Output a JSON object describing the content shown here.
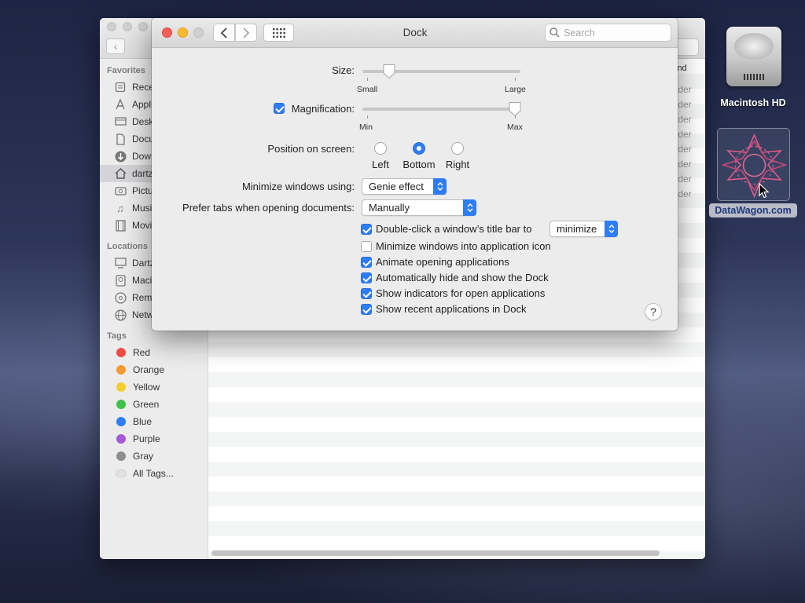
{
  "colors": {
    "accent": "#2f7df6",
    "close": "#fc5f57",
    "minimize": "#fdbc2e"
  },
  "finder": {
    "sidebar": {
      "favorites_header": "Favorites",
      "favorites": [
        {
          "label": "Rece",
          "icon": "recents-icon"
        },
        {
          "label": "Appli",
          "icon": "applications-icon"
        },
        {
          "label": "Desk",
          "icon": "desktop-icon"
        },
        {
          "label": "Docu",
          "icon": "documents-icon"
        },
        {
          "label": "Down",
          "icon": "downloads-icon"
        },
        {
          "label": "dartz",
          "icon": "home-icon"
        },
        {
          "label": "Pictu",
          "icon": "pictures-icon"
        },
        {
          "label": "Music",
          "icon": "music-icon"
        },
        {
          "label": "Movie",
          "icon": "movies-icon"
        }
      ],
      "locations_header": "Locations",
      "locations": [
        {
          "label": "Dartz",
          "icon": "computer-icon"
        },
        {
          "label": "Macin",
          "icon": "disk-icon"
        },
        {
          "label": "Remo",
          "icon": "remote-disc-icon"
        },
        {
          "label": "Netw",
          "icon": "network-icon"
        }
      ],
      "tags_header": "Tags",
      "tags": [
        {
          "label": "Red",
          "color": "#f04a44"
        },
        {
          "label": "Orange",
          "color": "#f39a32"
        },
        {
          "label": "Yellow",
          "color": "#f5cf2e"
        },
        {
          "label": "Green",
          "color": "#3ec24b"
        },
        {
          "label": "Blue",
          "color": "#2f7df6"
        },
        {
          "label": "Purple",
          "color": "#a659d6"
        },
        {
          "label": "Gray",
          "color": "#8e8e8e"
        }
      ],
      "all_tags": "All Tags..."
    },
    "column_kind": "ind",
    "kind_cells": [
      "older",
      "older",
      "older",
      "older",
      "older",
      "older",
      "older",
      "older"
    ]
  },
  "desktop": {
    "hd_label": "Macintosh HD",
    "dw_label": "DataWagon.com"
  },
  "prefs": {
    "title": "Dock",
    "search_placeholder": "Search",
    "size": {
      "label": "Size:",
      "min_label": "Small",
      "max_label": "Large",
      "value": 0.15
    },
    "magnification": {
      "label": "Magnification:",
      "checked": true,
      "min_label": "Min",
      "max_label": "Max",
      "value": 1.0
    },
    "position": {
      "label": "Position on screen:",
      "options": [
        "Left",
        "Bottom",
        "Right"
      ],
      "selected": "Bottom"
    },
    "minimize_using": {
      "label": "Minimize windows using:",
      "value": "Genie effect"
    },
    "prefer_tabs": {
      "label": "Prefer tabs when opening documents:",
      "value": "Manually"
    },
    "double_click": {
      "label": "Double-click a window’s title bar to",
      "value": "minimize",
      "checked": true
    },
    "checkboxes": [
      {
        "label": "Minimize windows into application icon",
        "checked": false
      },
      {
        "label": "Animate opening applications",
        "checked": true
      },
      {
        "label": "Automatically hide and show the Dock",
        "checked": true
      },
      {
        "label": "Show indicators for open applications",
        "checked": true
      },
      {
        "label": "Show recent applications in Dock",
        "checked": true
      }
    ],
    "help": "?"
  }
}
